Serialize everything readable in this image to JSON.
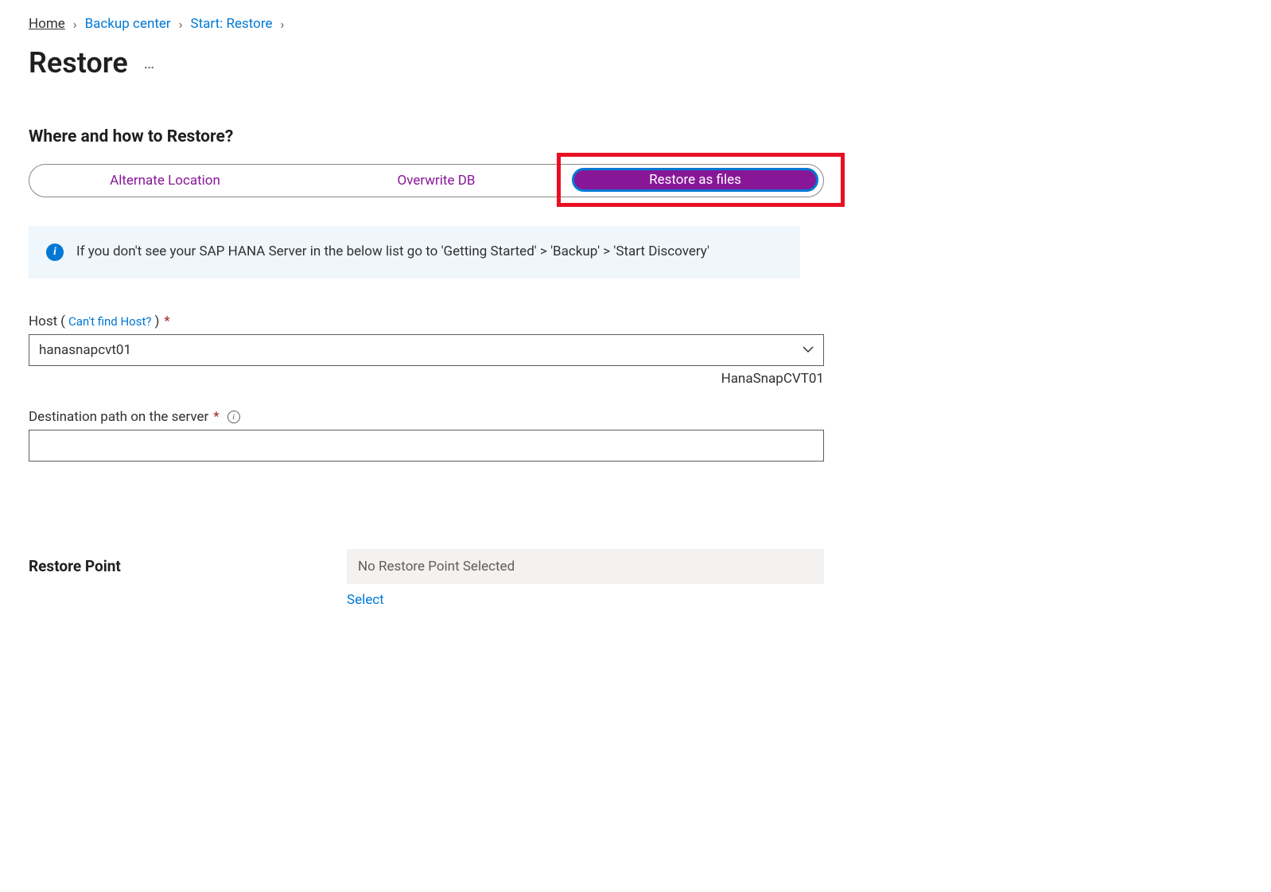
{
  "breadcrumb": {
    "home": "Home",
    "backup_center": "Backup center",
    "start_restore": "Start: Restore"
  },
  "page_title": "Restore",
  "section_heading": "Where and how to Restore?",
  "pills": {
    "alternate": "Alternate Location",
    "overwrite": "Overwrite DB",
    "restore_files": "Restore as files"
  },
  "info_banner": "If you don't see your SAP HANA Server in the below list go to 'Getting Started' > 'Backup' > 'Start Discovery'",
  "host": {
    "label_prefix": "Host",
    "paren_open": "(",
    "link": "Can't find Host?",
    "paren_close": ")",
    "value": "hanasnapcvt01",
    "helper": "HanaSnapCVT01"
  },
  "dest_path": {
    "label": "Destination path on the server",
    "value": ""
  },
  "restore_point": {
    "label": "Restore Point",
    "value": "No Restore Point Selected",
    "select_link": "Select"
  }
}
